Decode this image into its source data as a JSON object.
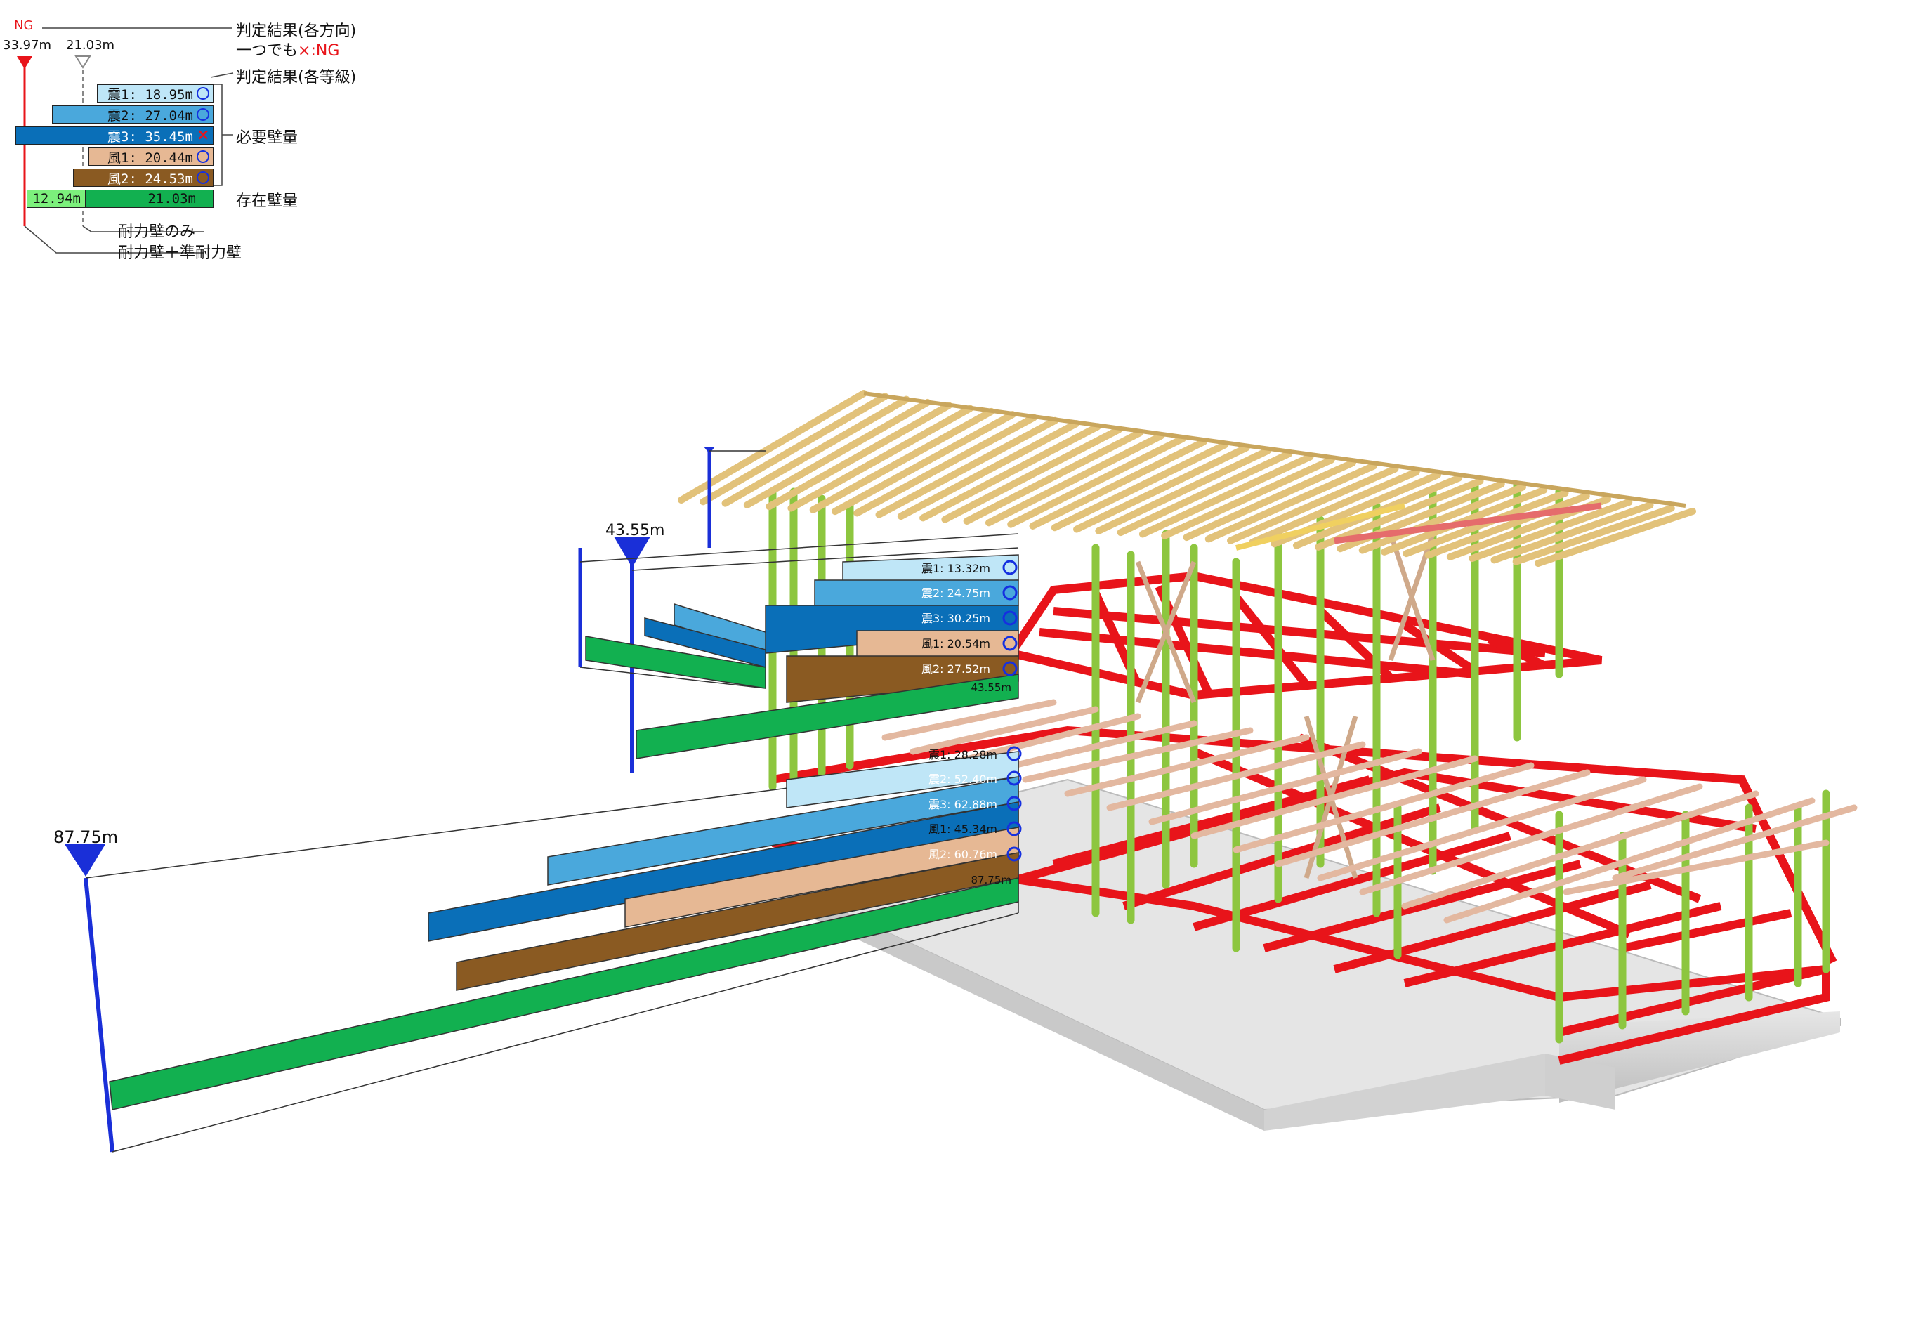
{
  "legend": {
    "ng_top": "NG",
    "max_total": "33.97m",
    "max_wall": "21.03m",
    "result_dir_line1": "判定結果(各方向)",
    "result_dir_line2_prefix": "一つでも",
    "result_dir_line2_cross": "×",
    "result_dir_line2_suffix": ":NG",
    "result_grade": "判定結果(各等級)",
    "required": "必要壁量",
    "existing": "存在壁量",
    "wall_only": "耐力壁のみ",
    "wall_plus": "耐力壁＋準耐力壁",
    "bars": [
      {
        "label": "震1: 18.95m",
        "color": "#bfe6f7",
        "mark": "ok"
      },
      {
        "label": "震2: 27.04m",
        "color": "#4aa8dc",
        "mark": "ok"
      },
      {
        "label": "震3: 35.45m",
        "color": "#0a6fb8",
        "mark": "ng"
      },
      {
        "label": "風1: 20.44m",
        "color": "#e6b894",
        "mark": "ok"
      },
      {
        "label": "風2: 24.53m",
        "color": "#8a5a22",
        "mark": "ok"
      }
    ],
    "exist_extra": "12.94m",
    "exist_main": "21.03m"
  },
  "floor2": {
    "total": "43.55m",
    "bars": [
      {
        "label": "震1: 13.32m",
        "color": "#bfe6f7"
      },
      {
        "label": "震2: 24.75m",
        "color": "#4aa8dc"
      },
      {
        "label": "震3: 30.25m",
        "color": "#0a6fb8"
      },
      {
        "label": "風1: 20.54m",
        "color": "#e6b894"
      },
      {
        "label": "風2: 27.52m",
        "color": "#8a5a22"
      }
    ],
    "exist": "43.55m"
  },
  "floor1": {
    "total": "87.75m",
    "bars": [
      {
        "label": "震1: 28.28m",
        "color": "#bfe6f7"
      },
      {
        "label": "震2: 52.40m",
        "color": "#4aa8dc"
      },
      {
        "label": "震3: 62.88m",
        "color": "#0a6fb8"
      },
      {
        "label": "風1: 45.34m",
        "color": "#e6b894"
      },
      {
        "label": "風2: 60.76m",
        "color": "#8a5a22"
      }
    ],
    "exist": "87.75m"
  },
  "colors": {
    "rafter": "#e2c27a",
    "stud": "#8dc63f",
    "sill": "#e8141a",
    "exist": "#12b050",
    "exist_light": "#7cf07c",
    "dim": "#1a2fd8",
    "foundation": "#d8d8d8"
  }
}
